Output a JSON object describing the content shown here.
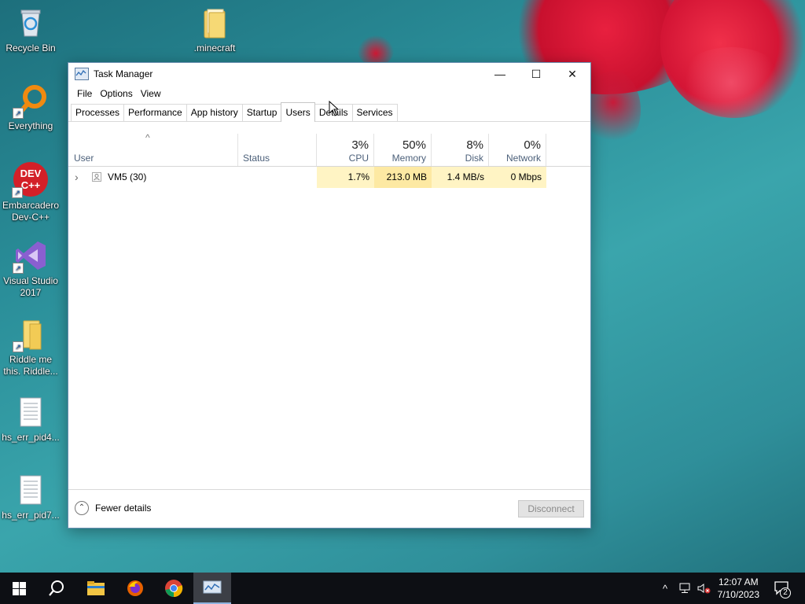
{
  "desktop": {
    "icons": [
      {
        "label": "Recycle Bin"
      },
      {
        "label": ".minecraft"
      },
      {
        "label": "Everything"
      },
      {
        "label": "Embarcadero Dev-C++"
      },
      {
        "label": "Visual Studio 2017"
      },
      {
        "label": "Riddle me this. Riddle..."
      },
      {
        "label": "hs_err_pid4..."
      },
      {
        "label": "hs_err_pid7..."
      }
    ],
    "devcpp_logo_text": "DEV C++"
  },
  "window": {
    "title": "Task Manager",
    "controls": {
      "minimize": "—",
      "maximize": "☐",
      "close": "✕"
    },
    "menu": [
      "File",
      "Options",
      "View"
    ],
    "tabs": [
      "Processes",
      "Performance",
      "App history",
      "Startup",
      "Users",
      "Details",
      "Services"
    ],
    "active_tab": "Users",
    "sort_indicator": "^",
    "columns": {
      "user": "User",
      "status": "Status",
      "cpu": {
        "percent": "3%",
        "label": "CPU"
      },
      "memory": {
        "percent": "50%",
        "label": "Memory"
      },
      "disk": {
        "percent": "8%",
        "label": "Disk"
      },
      "network": {
        "percent": "0%",
        "label": "Network"
      }
    },
    "rows": [
      {
        "expander": "›",
        "user": "VM5 (30)",
        "status": "",
        "cpu": "1.7%",
        "memory": "213.0 MB",
        "disk": "1.4 MB/s",
        "network": "0 Mbps"
      }
    ],
    "footer": {
      "fewer_details_icon": "⌃",
      "fewer_details": "Fewer details",
      "disconnect": "Disconnect"
    }
  },
  "taskbar": {
    "tray_chevron": "^",
    "time": "12:07 AM",
    "date": "7/10/2023",
    "notification_count": "2"
  },
  "colors": {
    "heat_light": "#fff4c4",
    "heat_medium": "#fde9a3",
    "taskbar": "#0d0f14",
    "accent": "#8fb3df"
  }
}
